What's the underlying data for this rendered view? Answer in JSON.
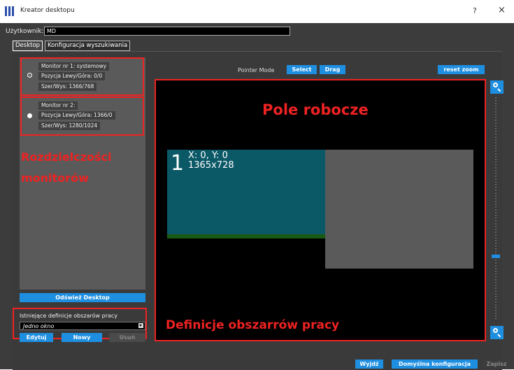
{
  "window": {
    "title": "Kreator desktopu",
    "help": "?",
    "close": "×"
  },
  "user": {
    "label": "Użytkownik:",
    "value": "MD"
  },
  "tabs": [
    {
      "label": "Desktop"
    },
    {
      "label": "Konfiguracja wyszukiwania"
    }
  ],
  "monitors": [
    {
      "name": "Monitor nr 1: systemowy",
      "position": "Pozycja Lewy/Góra: 0/0",
      "size": "Szer/Wys: 1366/768",
      "selected": true
    },
    {
      "name": "Monitor nr 2:",
      "position": "Pozycja Lewy/Góra: 1366/0",
      "size": "Szer/Wys: 1280/1024",
      "selected": false
    }
  ],
  "annotations": {
    "resolutions": "Rozdzielczości\nmonitorów",
    "workspace": "Pole robocze",
    "definitions": "Definicje obszarrów pracy"
  },
  "left": {
    "refresh_button": "Odśwież Desktop",
    "existing_label": "Istniejące definicje obszarów pracy",
    "selected_definition": "Jedno okno",
    "edit_button": "Edytuj",
    "new_button": "Nowy",
    "delete_button": "Usuń"
  },
  "toolbar": {
    "pointer_mode_label": "Pointer Mode",
    "select_button": "Select",
    "drag_button": "Drag",
    "reset_zoom_button": "reset zoom"
  },
  "canvas": {
    "monitor1": {
      "number": "1",
      "coords": "X: 0, Y: 0",
      "size": "1365x728"
    }
  },
  "footer": {
    "exit_button": "Wyjdź",
    "default_config_button": "Domyślna konfiguracja",
    "save_button": "Zapisz"
  },
  "colors": {
    "accent": "#1e8ee0",
    "annotation": "#ee2222",
    "monitor1": "#0b5866",
    "monitor2": "#5a5a5a"
  }
}
